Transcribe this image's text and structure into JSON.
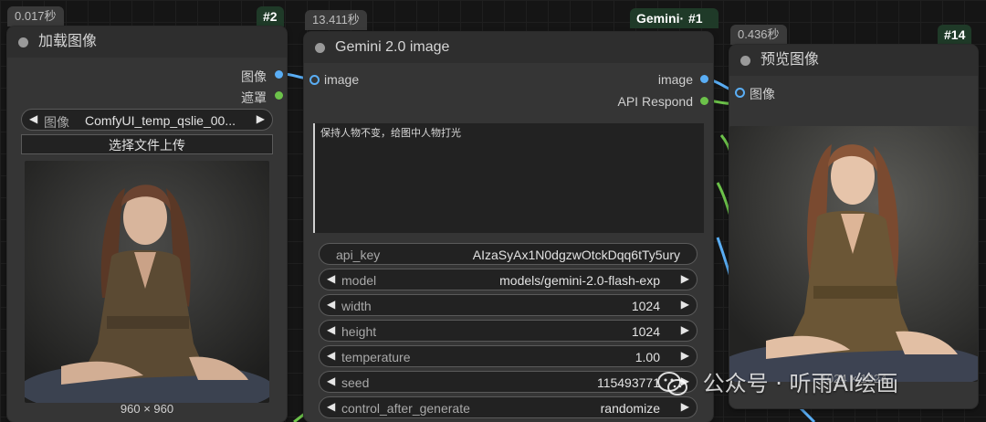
{
  "colors": {
    "canvas": "#151515",
    "node_bg": "#353535",
    "badge_bg": "#1f3a28",
    "socket_image": "#5aaef5",
    "socket_mask": "#6cc24a"
  },
  "load_node": {
    "timing": "0.017秒",
    "id": "#2",
    "title": "加载图像",
    "outputs": [
      "图像",
      "遮罩"
    ],
    "image_combo": {
      "label": "图像",
      "value": "ComfyUI_temp_qslie_00..."
    },
    "upload_button": "选择文件上传",
    "preview_caption": "960 × 960"
  },
  "gemini_node": {
    "timing": "13.411秒",
    "badge_name": "Gemini·",
    "id": "#1",
    "title": "Gemini 2.0 image",
    "input": "image",
    "outputs": [
      "image",
      "API Respond"
    ],
    "prompt": "保持人物不变，给图中人物打光",
    "widgets": [
      {
        "label": "api_key",
        "value": "AIzaSyAx1N0dgzwOtckDqq6tTy5ury",
        "arrows": false
      },
      {
        "label": "model",
        "value": "models/gemini-2.0-flash-exp",
        "arrows": true
      },
      {
        "label": "width",
        "value": "1024",
        "arrows": true
      },
      {
        "label": "height",
        "value": "1024",
        "arrows": true
      },
      {
        "label": "temperature",
        "value": "1.00",
        "arrows": true
      },
      {
        "label": "seed",
        "value": "115493771",
        "arrows": true
      },
      {
        "label": "control_after_generate",
        "value": "randomize",
        "arrows": true
      }
    ]
  },
  "preview_node": {
    "timing": "0.436秒",
    "id": "#14",
    "title": "预览图像",
    "input": "图像",
    "caption_partial": "1024 × 1024"
  },
  "watermark": {
    "text": "公众号 · 听雨AI绘画",
    "icon": "wechat-icon"
  },
  "icons": {
    "arrow_left": "◀",
    "arrow_right": "▶"
  }
}
